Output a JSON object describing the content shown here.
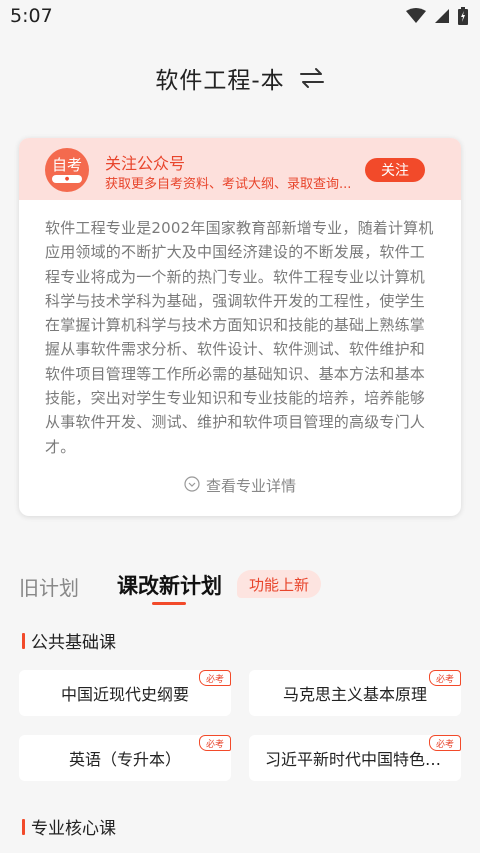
{
  "status_bar": {
    "time": "5:07"
  },
  "header": {
    "title": "软件工程-本"
  },
  "promo": {
    "logo_text": "自考",
    "title": "关注公众号",
    "subtitle": "获取更多自考资料、考试大纲、录取查询...",
    "follow_label": "关注"
  },
  "description": "软件工程专业是2002年国家教育部新增专业，随着计算机应用领域的不断扩大及中国经济建设的不断发展，软件工程专业将成为一个新的热门专业。软件工程专业以计算机科学与技术学科为基础，强调软件开发的工程性，使学生在掌握计算机科学与技术方面知识和技能的基础上熟练掌握从事软件需求分析、软件设计、软件测试、软件维护和软件项目管理等工作所必需的基础知识、基本方法和基本技能，突出对学生专业知识和专业技能的培养，培养能够从事软件开发、测试、维护和软件项目管理的高级专门人才。",
  "detail_link": "查看专业详情",
  "tabs": {
    "old": "旧计划",
    "new": "课改新计划",
    "badge": "功能上新"
  },
  "sections": {
    "public": {
      "title": "公共基础课",
      "courses": [
        {
          "name": "中国近现代史纲要",
          "tag": "必考"
        },
        {
          "name": "马克思主义基本原理",
          "tag": "必考"
        },
        {
          "name": "英语（专升本）",
          "tag": "必考"
        },
        {
          "name": "习近平新时代中国特色社会主义思想概论",
          "tag": "必考"
        }
      ]
    },
    "core": {
      "title": "专业核心课"
    }
  },
  "colors": {
    "accent": "#f24a2a",
    "banner_bg": "#fde0dc"
  }
}
